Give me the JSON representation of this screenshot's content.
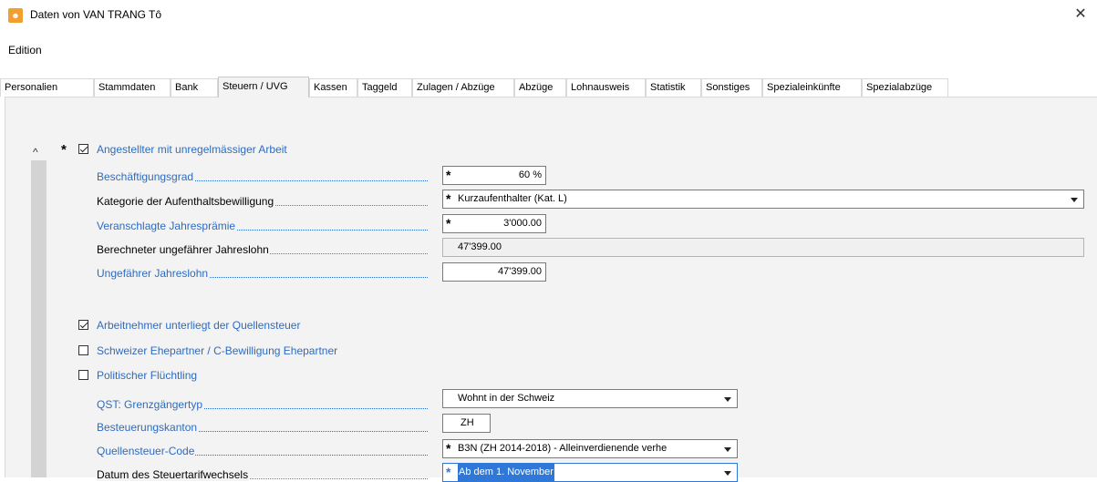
{
  "window": {
    "title": "Daten von VAN TRANG Tô",
    "close_glyph": "✕"
  },
  "menu": {
    "edition": "Edition"
  },
  "tabs": [
    "Personalien",
    "Stammdaten",
    "Bank",
    "Steuern / UVG",
    "Kassen",
    "Taggeld",
    "Zulagen / Abzüge",
    "Abzüge",
    "Lohnausweis",
    "Statistik",
    "Sonstiges",
    "Spezialeinkünfte",
    "Spezialabzüge"
  ],
  "active_tab": "Steuern / UVG",
  "section": {
    "collapse_glyph": "^",
    "irregular_work": {
      "label": "Angestellter mit unregelmässiger Arbeit",
      "checked": true
    }
  },
  "fields": {
    "beschaeftigungsgrad": {
      "label": "Beschäftigungsgrad",
      "value": "60 %"
    },
    "kategorie": {
      "label": "Kategorie der Aufenthaltsbewilligung",
      "value": "Kurzaufenthalter (Kat. L)"
    },
    "jahrespraemie": {
      "label": "Veranschlagte Jahresprämie",
      "value": "3'000.00"
    },
    "berechneter_lohn": {
      "label": "Berechneter ungefährer Jahreslohn",
      "value": "47'399.00"
    },
    "ungefaehrer_lohn": {
      "label": "Ungefährer Jahreslohn",
      "value": "47'399.00"
    },
    "grenzgaengertyp": {
      "label": "QST: Grenzgängertyp",
      "value": "Wohnt in der Schweiz"
    },
    "kanton": {
      "label": "Besteuerungskanton",
      "value": "ZH"
    },
    "qst_code": {
      "label": "Quellensteuer-Code",
      "value": "B3N (ZH 2014-2018) - Alleinverdienende verhe"
    },
    "tarifwechsel": {
      "label": "Datum des Steuertarifwechsels",
      "value": "Ab dem 1. November"
    }
  },
  "checkboxes": {
    "quellensteuer": {
      "label": "Arbeitnehmer unterliegt der Quellensteuer",
      "checked": true
    },
    "ehepartner": {
      "label": "Schweizer Ehepartner / C-Bewilligung Ehepartner",
      "checked": false
    },
    "fluechtling": {
      "label": "Politischer Flüchtling",
      "checked": false
    }
  },
  "required_marker": "*",
  "colors": {
    "link_blue": "#2f6bbf",
    "panel": "#f3f3f3",
    "selection": "#3078d8"
  }
}
